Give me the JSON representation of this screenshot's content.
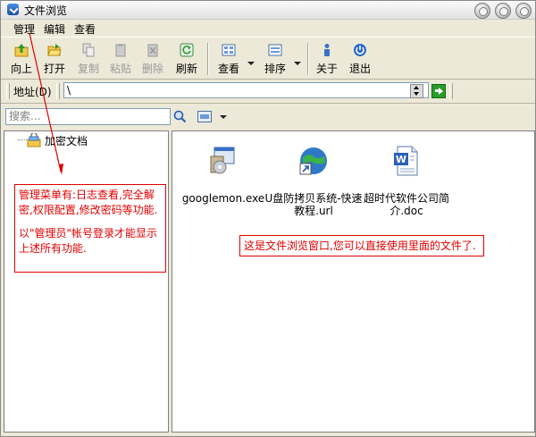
{
  "window": {
    "title": "文件浏览"
  },
  "menubar": {
    "items": [
      "管理",
      "编辑",
      "查看"
    ]
  },
  "toolbar": {
    "buttons": [
      {
        "label": "向上",
        "icon": "up-folder-icon",
        "enabled": true
      },
      {
        "label": "打开",
        "icon": "open-folder-icon",
        "enabled": true
      },
      {
        "label": "复制",
        "icon": "copy-icon",
        "enabled": false
      },
      {
        "label": "粘贴",
        "icon": "paste-icon",
        "enabled": false
      },
      {
        "label": "删除",
        "icon": "delete-icon",
        "enabled": false
      },
      {
        "label": "刷新",
        "icon": "refresh-icon",
        "enabled": true
      },
      {
        "label": "查看",
        "icon": "view-icon",
        "enabled": true
      },
      {
        "label": "排序",
        "icon": "sort-icon",
        "enabled": true
      },
      {
        "label": "关于",
        "icon": "about-icon",
        "enabled": true
      },
      {
        "label": "退出",
        "icon": "exit-icon",
        "enabled": true
      }
    ]
  },
  "address": {
    "label": "地址(D)",
    "value": "\\"
  },
  "search": {
    "placeholder": "搜索..."
  },
  "tree": {
    "root_label": "加密文档"
  },
  "files": [
    {
      "name": "googlemon.exe",
      "icon": "installer-exe-icon"
    },
    {
      "name": "U盘防拷贝系统-快速教程.url",
      "icon": "internet-shortcut-icon"
    },
    {
      "name": "超时代软件公司简介.doc",
      "icon": "word-document-icon"
    }
  ],
  "annotations": {
    "menu_note_1": "管理菜单有:日志查看,完全解密,权限配置,修改密码等功能.",
    "menu_note_2": "以\"管理员\"帐号登录才能显示上述所有功能.",
    "window_note": "这是文件浏览窗口,您可以直接使用里面的文件了."
  },
  "colors": {
    "annotation": "#e00000",
    "window_bg": "#ece9d8"
  }
}
